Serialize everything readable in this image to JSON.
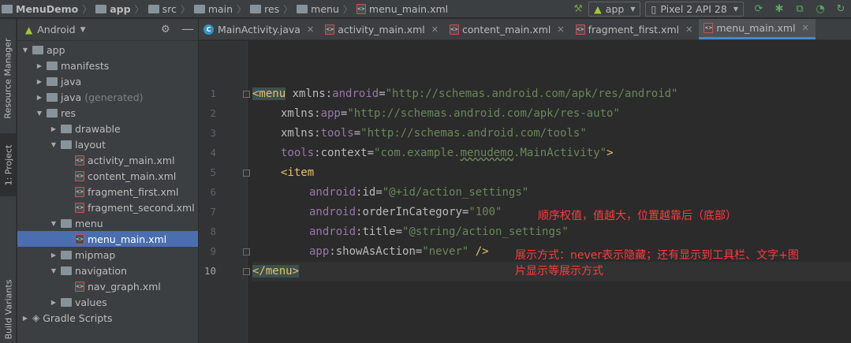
{
  "breadcrumb": {
    "project": "MenuDemo",
    "items": [
      "app",
      "src",
      "main",
      "res",
      "menu",
      "menu_main.xml"
    ]
  },
  "toolbar": {
    "run_config": "app",
    "device": "Pixel 2 API 28"
  },
  "left_strip": {
    "resource_manager": "Resource Manager",
    "project": "1: Project",
    "build_variants": "Build Variants"
  },
  "project_panel": {
    "view": "Android"
  },
  "tree": [
    {
      "label": "app",
      "level": 0,
      "expanded": true,
      "icon": "module-folder-icon"
    },
    {
      "label": "manifests",
      "level": 1,
      "expanded": false,
      "icon": "folder-icon"
    },
    {
      "label": "java",
      "level": 1,
      "expanded": false,
      "icon": "folder-icon"
    },
    {
      "label": "java",
      "suffix": "(generated)",
      "level": 1,
      "expanded": false,
      "icon": "generated-folder-icon"
    },
    {
      "label": "res",
      "level": 1,
      "expanded": true,
      "icon": "res-folder-icon"
    },
    {
      "label": "drawable",
      "level": 2,
      "expanded": false,
      "icon": "folder-icon"
    },
    {
      "label": "layout",
      "level": 2,
      "expanded": true,
      "icon": "folder-icon"
    },
    {
      "label": "activity_main.xml",
      "level": 3,
      "icon": "xml-file-icon"
    },
    {
      "label": "content_main.xml",
      "level": 3,
      "icon": "xml-file-icon"
    },
    {
      "label": "fragment_first.xml",
      "level": 3,
      "icon": "xml-file-icon"
    },
    {
      "label": "fragment_second.xml",
      "level": 3,
      "icon": "xml-file-icon"
    },
    {
      "label": "menu",
      "level": 2,
      "expanded": true,
      "icon": "folder-icon"
    },
    {
      "label": "menu_main.xml",
      "level": 3,
      "icon": "xml-file-icon",
      "selected": true
    },
    {
      "label": "mipmap",
      "level": 2,
      "expanded": false,
      "icon": "folder-icon"
    },
    {
      "label": "navigation",
      "level": 2,
      "expanded": true,
      "icon": "folder-icon"
    },
    {
      "label": "nav_graph.xml",
      "level": 3,
      "icon": "xml-file-icon"
    },
    {
      "label": "values",
      "level": 2,
      "expanded": false,
      "icon": "folder-icon"
    },
    {
      "label": "Gradle Scripts",
      "level": 0,
      "expanded": false,
      "icon": "gradle-icon"
    }
  ],
  "tabs": [
    {
      "label": "MainActivity.java",
      "icon": "java-class-icon"
    },
    {
      "label": "activity_main.xml",
      "icon": "xml-file-icon"
    },
    {
      "label": "content_main.xml",
      "icon": "xml-file-icon"
    },
    {
      "label": "fragment_first.xml",
      "icon": "xml-file-icon"
    },
    {
      "label": "menu_main.xml",
      "icon": "xml-file-icon",
      "active": true
    }
  ],
  "line_numbers": [
    "1",
    "2",
    "3",
    "4",
    "5",
    "6",
    "7",
    "8",
    "9",
    "10"
  ],
  "code": {
    "l1_tag": "<menu",
    "l1_attr": " xmlns:",
    "l1_ns": "android",
    "l1_eq": "=",
    "l1_val": "\"http://schemas.android.com/apk/res/android\"",
    "l2_attr": "xmlns:",
    "l2_ns": "app",
    "l2_eq": "=",
    "l2_val": "\"http://schemas.android.com/apk/res-auto\"",
    "l3_attr": "xmlns:",
    "l3_ns": "tools",
    "l3_eq": "=",
    "l3_val": "\"http://schemas.android.com/tools\"",
    "l4_ns": "tools",
    "l4_attr": ":context",
    "l4_eq": "=",
    "l4_val_a": "\"com.example.",
    "l4_val_b": "menudemo",
    "l4_val_c": ".MainActivity\"",
    "l4_close": ">",
    "l5_tag": "<item",
    "l6_ns": "android",
    "l6_attr": ":id",
    "l6_eq": "=",
    "l6_val": "\"@+id/action_settings\"",
    "l7_ns": "android",
    "l7_attr": ":orderInCategory",
    "l7_eq": "=",
    "l7_val": "\"100\"",
    "l8_ns": "android",
    "l8_attr": ":title",
    "l8_eq": "=",
    "l8_val": "\"@string/action_settings\"",
    "l9_ns": "app",
    "l9_attr": ":showAsAction",
    "l9_eq": "=",
    "l9_val": "\"never\"",
    "l9_close": " />",
    "l10_tag": "</menu>"
  },
  "annotations": {
    "order_note": "顺序权值，值越大，位置越靠后（底部）",
    "show_note_1": "展示方式：never表示隐藏；还有显示到工具栏、文字+图",
    "show_note_2": "片显示等展示方式"
  },
  "colors": {
    "tag": "#e8bf6a",
    "namespace": "#9876aa",
    "string": "#6a8759",
    "selection": "#4b6eaf",
    "annotation": "#ff3b3b"
  }
}
